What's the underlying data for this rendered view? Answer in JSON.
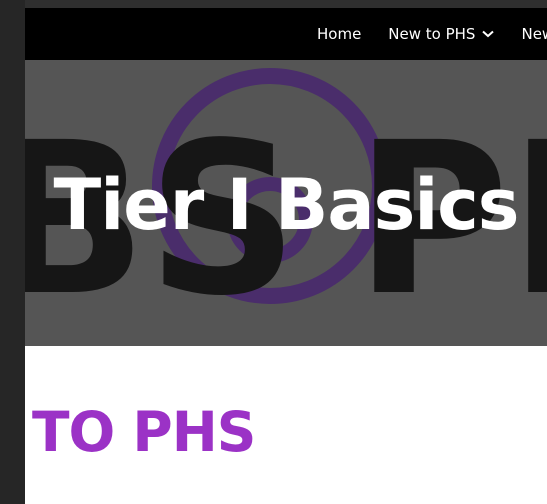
{
  "nav": {
    "items": [
      {
        "label": "Home",
        "has_dropdown": false
      },
      {
        "label": "New to PHS",
        "has_dropdown": true
      },
      {
        "label": "New to",
        "has_dropdown": false
      }
    ]
  },
  "hero": {
    "title": "Tier I Basics",
    "background_letters_left": "BS",
    "background_letters_right": "PI",
    "overlay_color": "#555555",
    "ring_color": "#4a2d6b"
  },
  "main": {
    "heading": "TO PHS",
    "heading_color": "#9b32c6"
  }
}
